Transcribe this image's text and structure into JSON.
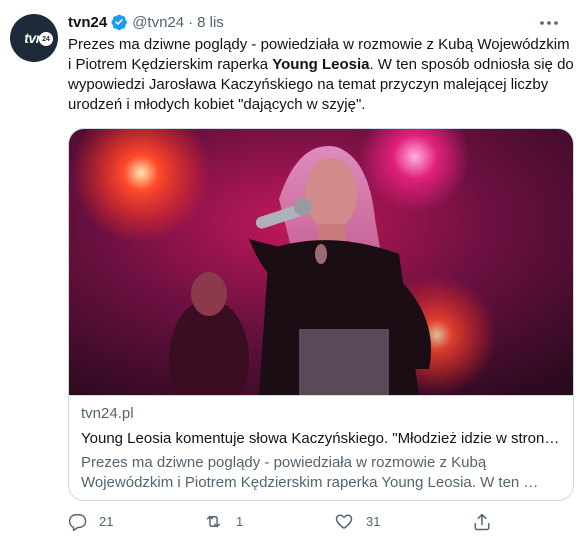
{
  "author": {
    "name": "tvn24",
    "handle": "@tvn24",
    "separator": "·",
    "time": "8 lis",
    "avatar_text": "tvn",
    "avatar_badge": "24",
    "verified_icon": "verified-badge-icon"
  },
  "tweet": {
    "text_part1": "Prezes ma dziwne poglądy - powiedziała w rozmowie z Kubą Wojewódzkim i Piotrem Kędzierskim raperka ",
    "text_bold": "Young Leosia",
    "text_part2": ". W ten sposób odniosła się do wypowiedzi Jarosława Kaczyńskiego na temat przyczyn malejącej liczby urodzeń i młodych kobiet \"dających w szyję\"."
  },
  "card": {
    "domain": "tvn24.pl",
    "title": "Young Leosia komentuje słowa Kaczyńskiego. \"Młodzież idzie w stronę…",
    "description": "Prezes ma dziwne poglądy - powiedziała w rozmowie z Kubą Wojewódzkim i Piotrem Kędzierskim raperka Young Leosia. W ten …"
  },
  "actions": {
    "reply_count": "21",
    "retweet_count": "1",
    "like_count": "31",
    "share_count": ""
  },
  "colors": {
    "accent": "#1d9bf0",
    "text_primary": "#0f1419",
    "text_secondary": "#536471",
    "border": "#cfd9de"
  }
}
